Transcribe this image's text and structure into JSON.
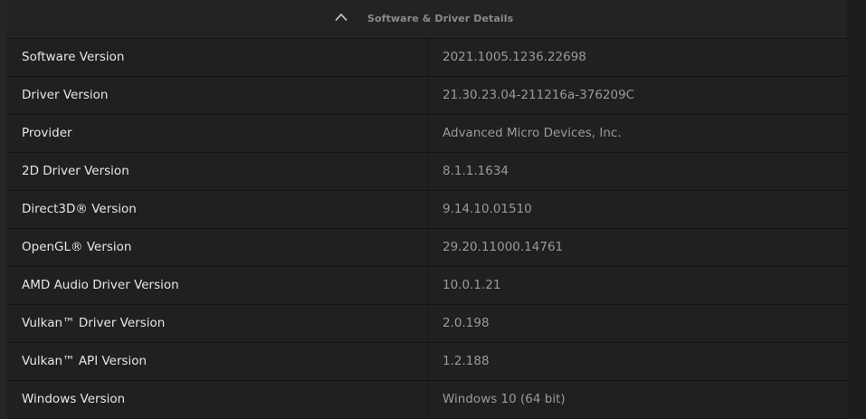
{
  "section": {
    "title": "Software & Driver Details",
    "expanded": true,
    "toggle_icon": "chevron-up-icon"
  },
  "rows": [
    {
      "label": "Software Version",
      "value": "2021.1005.1236.22698"
    },
    {
      "label": "Driver Version",
      "value": "21.30.23.04-211216a-376209C"
    },
    {
      "label": "Provider",
      "value": "Advanced Micro Devices, Inc."
    },
    {
      "label": "2D Driver Version",
      "value": "8.1.1.1634"
    },
    {
      "label": "Direct3D® Version",
      "value": "9.14.10.01510"
    },
    {
      "label": "OpenGL® Version",
      "value": "29.20.11000.14761"
    },
    {
      "label": "AMD Audio Driver Version",
      "value": "10.0.1.21"
    },
    {
      "label": "Vulkan™ Driver Version",
      "value": "2.0.198"
    },
    {
      "label": "Vulkan™ API Version",
      "value": "1.2.188"
    },
    {
      "label": "Windows Version",
      "value": "Windows 10 (64 bit)"
    }
  ],
  "colors": {
    "background": "#1b1b1b",
    "panel": "#202020",
    "label_text": "#e6e6e6",
    "value_text": "#9a9a9a",
    "header_text": "#8a8a8a"
  }
}
